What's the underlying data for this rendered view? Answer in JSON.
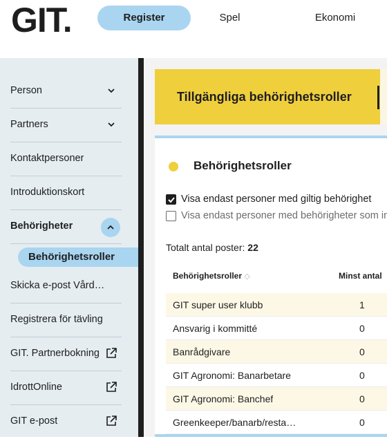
{
  "header": {
    "logo": "GIT.",
    "tabs": [
      {
        "label": "Register",
        "active": true
      },
      {
        "label": "Spel",
        "active": false
      },
      {
        "label": "Ekonomi",
        "active": false
      }
    ]
  },
  "sidebar": {
    "items": [
      {
        "label": "Person",
        "icon": "chevron-down-icon"
      },
      {
        "label": "Partners",
        "icon": "chevron-down-icon"
      },
      {
        "label": "Kontaktpersoner"
      },
      {
        "label": "Introduktionskort"
      },
      {
        "label": "Behörigheter",
        "icon": "chevron-up-icon",
        "expanded": true
      },
      {
        "label": "Skicka e-post Vårdnadshavare"
      },
      {
        "label": "Registrera för tävling"
      },
      {
        "label": "GIT. Partnerbokning",
        "icon": "external-link-icon"
      },
      {
        "label": "IdrottOnline",
        "icon": "external-link-icon"
      },
      {
        "label": "GIT e-post",
        "icon": "external-link-icon"
      }
    ],
    "active_subitem": "Behörighetsroller"
  },
  "main": {
    "banner_title": "Tillgängliga behörighetsroller",
    "card_title": "Behörighetsroller",
    "filters": [
      {
        "label": "Visa endast personer med giltig behörighet",
        "checked": true
      },
      {
        "label": "Visa endast personer med behörigheter som inte",
        "checked": false
      }
    ],
    "total_label": "Totalt antal poster:",
    "total_value": "22",
    "table": {
      "columns": [
        "Behörighetsroller",
        "Minst antal"
      ],
      "sort_indicator": "◇",
      "rows": [
        [
          "GIT super user klubb",
          "1"
        ],
        [
          "Ansvarig i kommitté",
          "0"
        ],
        [
          "Banrådgivare",
          "0"
        ],
        [
          "GIT Agronomi: Banarbetare",
          "0"
        ],
        [
          "GIT Agronomi: Banchef",
          "0"
        ],
        [
          "Greenkeeper/banarb/restaurang",
          "0"
        ]
      ]
    }
  },
  "colors": {
    "accent_blue": "#a9d5f0",
    "accent_yellow": "#f0cf3d",
    "sidebar_bg": "#e5edf1",
    "row_alt": "#fdf8e6"
  }
}
